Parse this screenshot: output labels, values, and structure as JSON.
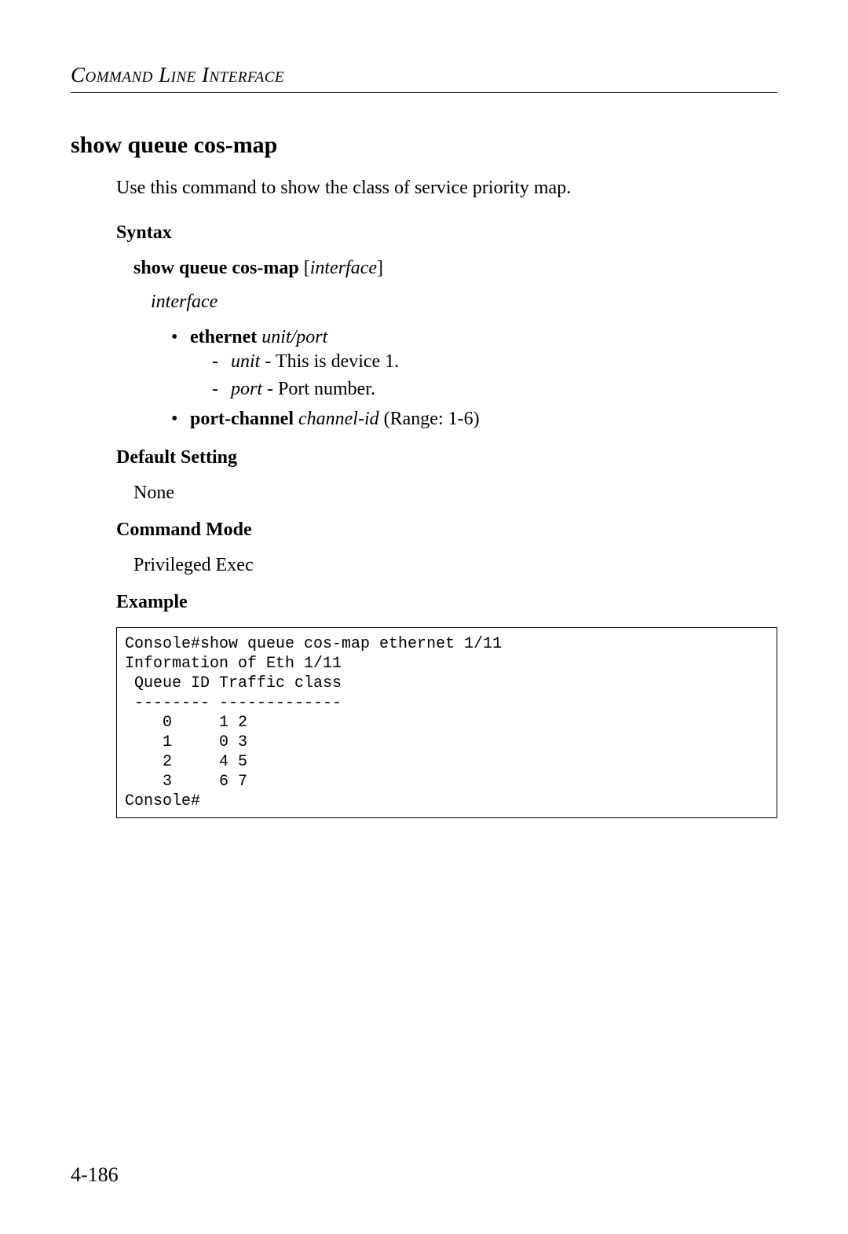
{
  "header": {
    "title": "Command Line Interface"
  },
  "command": {
    "heading": "show queue cos-map",
    "intro": "Use this command to show the class of service priority map."
  },
  "syntax": {
    "label": "Syntax",
    "command_bold": "show queue cos-map",
    "command_bracket_open": " [",
    "command_italic": "interface",
    "command_bracket_close": "]",
    "param_name": "interface",
    "items": {
      "ethernet_bold": "ethernet",
      "ethernet_italic": " unit/port",
      "unit_italic": "unit",
      "unit_desc": " - This is device 1.",
      "port_italic": "port",
      "port_desc": " - Port number.",
      "portchannel_bold": "port-channel",
      "portchannel_italic": " channel-id",
      "portchannel_desc": " (Range: 1-6)"
    }
  },
  "default_setting": {
    "label": "Default Setting",
    "value": "None"
  },
  "command_mode": {
    "label": "Command Mode",
    "value": "Privileged Exec"
  },
  "example": {
    "label": "Example",
    "content": "Console#show queue cos-map ethernet 1/11\nInformation of Eth 1/11\n Queue ID Traffic class\n -------- -------------\n    0     1 2\n    1     0 3\n    2     4 5\n    3     6 7\nConsole#"
  },
  "page_number": "4-186"
}
